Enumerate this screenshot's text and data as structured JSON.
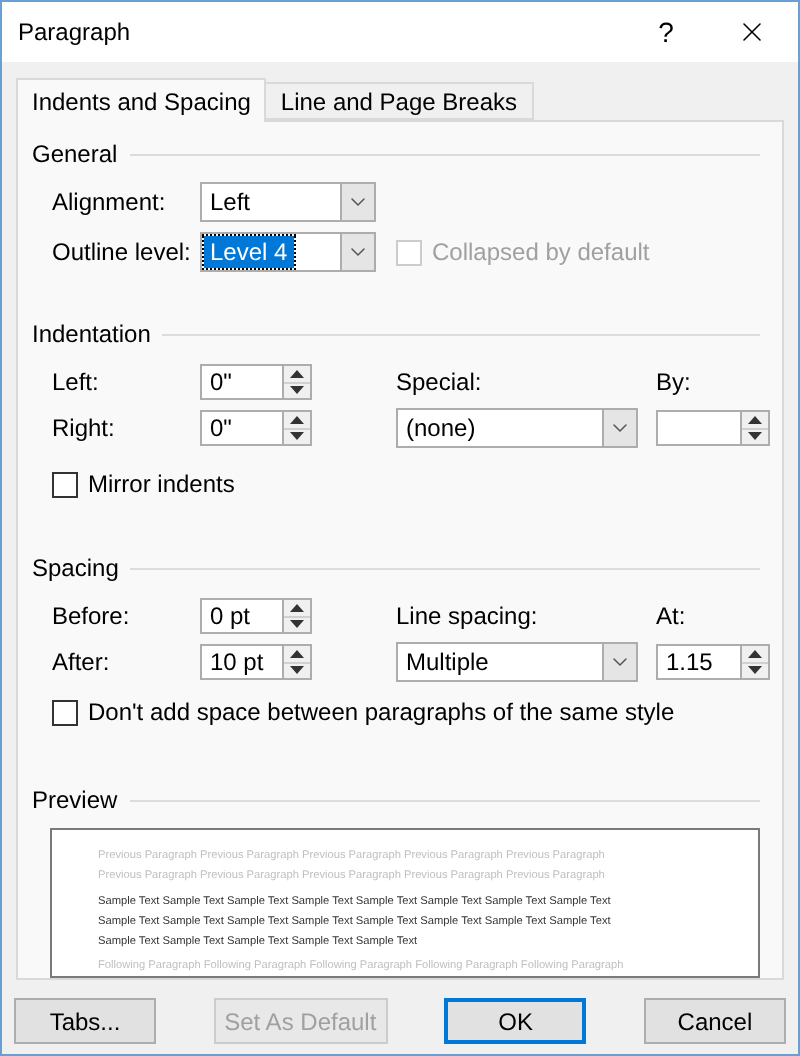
{
  "window": {
    "title": "Paragraph",
    "help": "?"
  },
  "tabs": [
    {
      "label": "Indents and Spacing",
      "selected": true
    },
    {
      "label": "Line and Page Breaks",
      "selected": false
    }
  ],
  "general": {
    "heading": "General",
    "alignment": {
      "label": "Alignment:",
      "value": "Left",
      "focused": false
    },
    "outline_level": {
      "label": "Outline level:",
      "value": "Level 4",
      "focused": true
    },
    "collapsed": {
      "label": "Collapsed by default",
      "checked": false,
      "disabled": true
    }
  },
  "indentation": {
    "heading": "Indentation",
    "left": {
      "label": "Left:",
      "value": "0\""
    },
    "right": {
      "label": "Right:",
      "value": "0\""
    },
    "special": {
      "label": "Special:",
      "value": "(none)"
    },
    "by": {
      "label": "By:"
    },
    "mirror": {
      "label": "Mirror indents",
      "checked": false,
      "disabled": false
    }
  },
  "spacing": {
    "heading": "Spacing",
    "before": {
      "label": "Before:",
      "value": "0 pt"
    },
    "after": {
      "label": "After:",
      "value": "10 pt"
    },
    "line_spacing": {
      "label": "Line spacing:",
      "value": "Multiple"
    },
    "at": {
      "label": "At:",
      "value": "1.15"
    },
    "no_space": {
      "label": "Don't add space between paragraphs of the same style",
      "checked": false,
      "disabled": false
    }
  },
  "preview": {
    "heading": "Preview",
    "previous": [
      "Previous Paragraph Previous Paragraph Previous Paragraph Previous Paragraph Previous Paragraph",
      "Previous Paragraph Previous Paragraph Previous Paragraph Previous Paragraph Previous Paragraph"
    ],
    "sample": [
      "Sample Text Sample Text Sample Text Sample Text Sample Text Sample Text Sample Text Sample Text",
      "Sample Text Sample Text Sample Text Sample Text Sample Text Sample Text Sample Text Sample Text",
      "Sample Text Sample Text Sample Text Sample Text Sample Text"
    ],
    "following": [
      "Following Paragraph Following Paragraph Following Paragraph Following Paragraph Following Paragraph"
    ]
  },
  "buttons": [
    {
      "label": "Tabs...",
      "disabled": false,
      "default": false
    },
    {
      "label": "Set As Default",
      "disabled": true,
      "default": false
    },
    {
      "label": "OK",
      "disabled": false,
      "default": true
    },
    {
      "label": "Cancel",
      "disabled": false,
      "default": false
    }
  ]
}
